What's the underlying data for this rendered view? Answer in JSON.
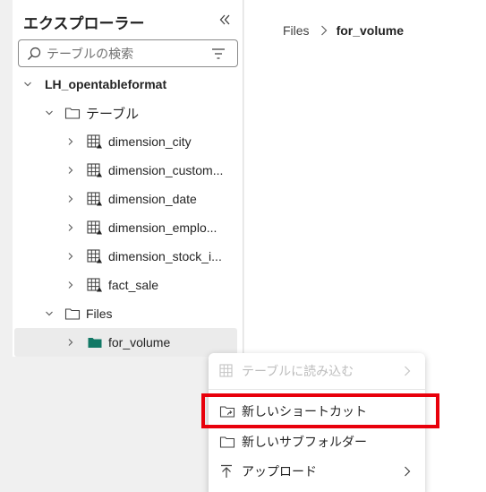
{
  "explorer": {
    "title": "エクスプローラー",
    "search_placeholder": "テーブルの検索",
    "root": {
      "label": "LH_opentableformat"
    },
    "tables_folder": {
      "label": "テーブル"
    },
    "tables": [
      {
        "label": "dimension_city"
      },
      {
        "label": "dimension_custom..."
      },
      {
        "label": "dimension_date"
      },
      {
        "label": "dimension_emplo..."
      },
      {
        "label": "dimension_stock_i..."
      },
      {
        "label": "fact_sale"
      }
    ],
    "files_folder": {
      "label": "Files"
    },
    "files": [
      {
        "label": "for_volume"
      }
    ]
  },
  "breadcrumb": {
    "root": "Files",
    "current": "for_volume"
  },
  "context_menu": {
    "items": [
      {
        "label": "テーブルに読み込む",
        "icon": "table-load-icon",
        "disabled": true,
        "submenu": true
      },
      {
        "label": "新しいショートカット",
        "icon": "shortcut-folder-icon",
        "disabled": false,
        "submenu": false
      },
      {
        "label": "新しいサブフォルダー",
        "icon": "folder-icon",
        "disabled": false,
        "submenu": false
      },
      {
        "label": "アップロード",
        "icon": "upload-icon",
        "disabled": false,
        "submenu": true
      }
    ]
  },
  "colors": {
    "highlight": "#e8000b",
    "folder_green": "#117865",
    "selected_row": "#ebebeb"
  }
}
